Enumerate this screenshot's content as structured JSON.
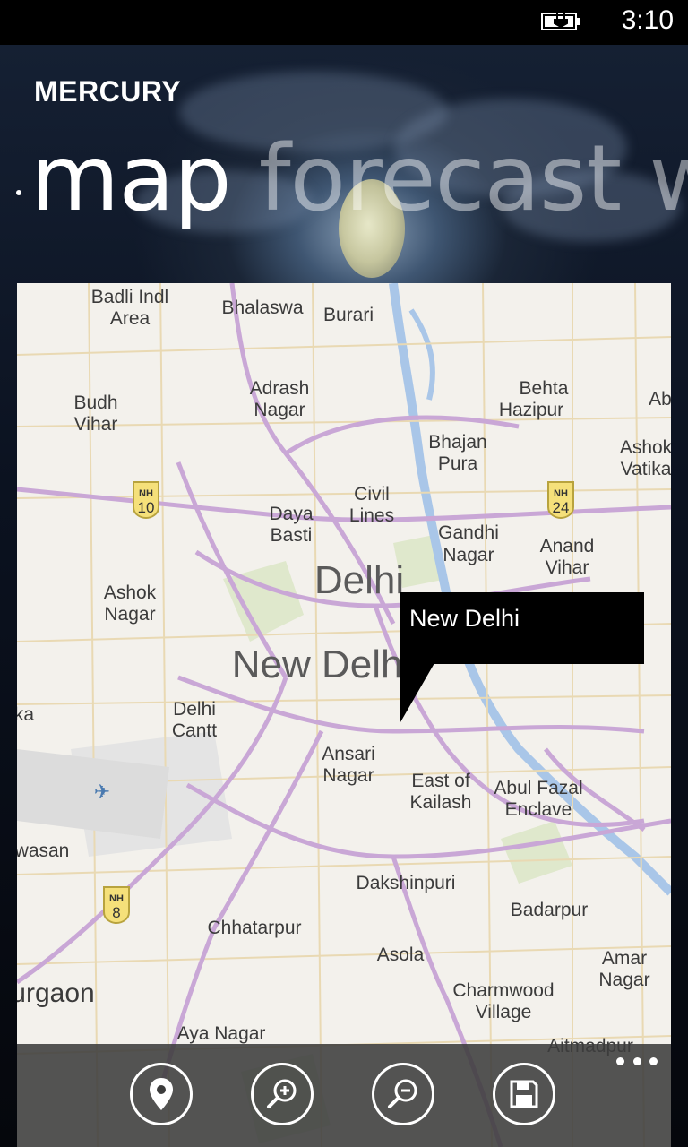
{
  "status_bar": {
    "time": "3:10"
  },
  "app": {
    "title": "MERCURY"
  },
  "pivot": {
    "items": [
      "map",
      "forecast",
      "w"
    ]
  },
  "map": {
    "callout": "New Delhi",
    "labels": {
      "badli": [
        "Badli Indl",
        "Area"
      ],
      "bhalaswa": "Bhalaswa",
      "burari": "Burari",
      "adrash": [
        "Adrash",
        "Nagar"
      ],
      "behta": [
        "Behta",
        "Hazipur"
      ],
      "ab": "Ab",
      "budh": [
        "Budh",
        "Vihar"
      ],
      "bhajan": [
        "Bhajan",
        "Pura"
      ],
      "ashok_vatika": [
        "Ashok",
        "Vatika"
      ],
      "nh10": [
        "NH",
        "10"
      ],
      "civil": [
        "Civil",
        "Lines"
      ],
      "nh24": [
        "NH",
        "24"
      ],
      "daya": [
        "Daya",
        "Basti"
      ],
      "gandhi": [
        "Gandhi",
        "Nagar"
      ],
      "anand": [
        "Anand",
        "Vihar"
      ],
      "delhi": "Delhi",
      "ashok_nagar": [
        "Ashok",
        "Nagar"
      ],
      "new_delhi": "New Delhi",
      "ka": "ka",
      "delhi_cantt": [
        "Delhi",
        "Cantt"
      ],
      "ansari": [
        "Ansari",
        "Nagar"
      ],
      "east_kailash": [
        "East of",
        "Kailash"
      ],
      "abul": [
        "Abul Fazal",
        "Enclave"
      ],
      "wasan": "wasan",
      "dakshinpuri": "Dakshinpuri",
      "nh8": [
        "NH",
        "8"
      ],
      "badarpur": "Badarpur",
      "chhatarpur": "Chhatarpur",
      "asola": "Asola",
      "amar": [
        "Amar",
        "Nagar"
      ],
      "gurgaon": "urgaon",
      "charmwood": [
        "Charmwood",
        "Village"
      ],
      "aya": "Aya Nagar",
      "aitmadpur": "Aitmadpur"
    }
  },
  "app_bar": {
    "buttons": [
      "location-icon",
      "zoom-in-icon",
      "zoom-out-icon",
      "save-icon"
    ],
    "more": "..."
  }
}
